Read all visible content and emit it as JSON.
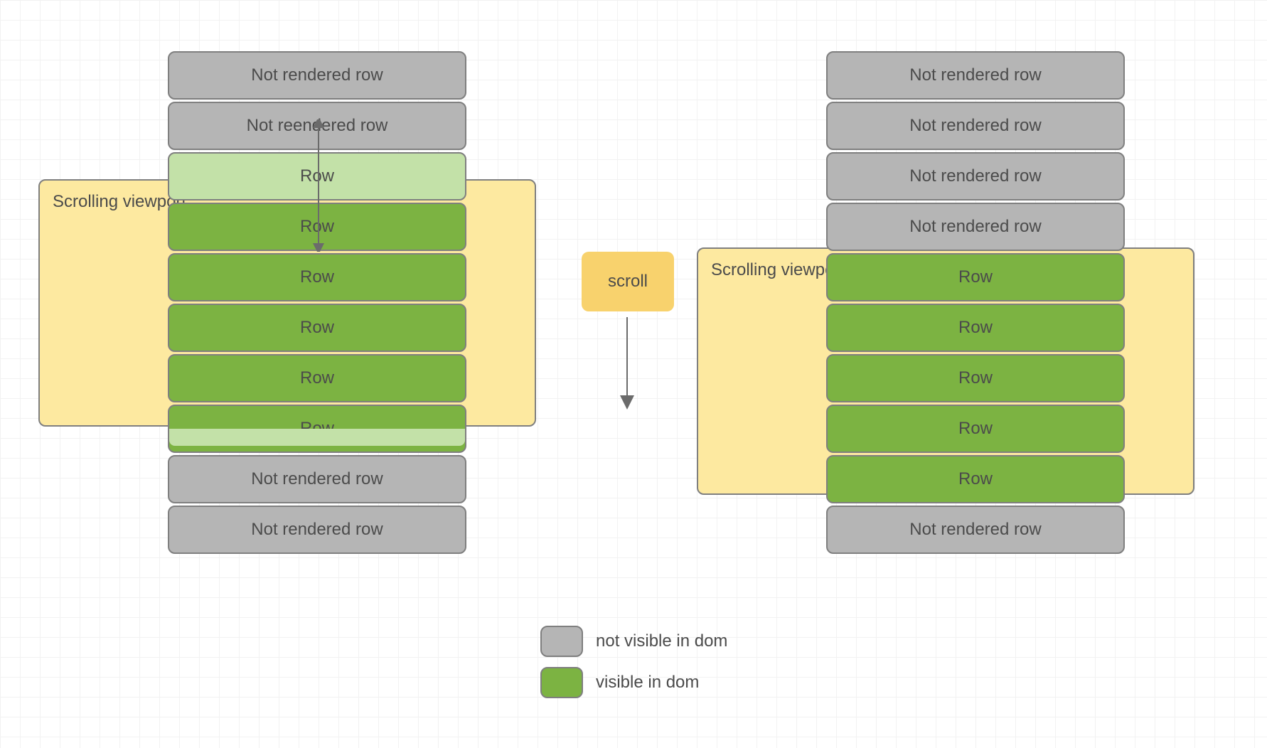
{
  "left": {
    "viewport_label": "Scrolling viewport",
    "rows": [
      {
        "label": "Not rendered row",
        "state": "grey"
      },
      {
        "label": "Not reendered row",
        "state": "grey"
      },
      {
        "label": "Row",
        "state": "light-green"
      },
      {
        "label": "Row",
        "state": "green"
      },
      {
        "label": "Row",
        "state": "green"
      },
      {
        "label": "Row",
        "state": "green"
      },
      {
        "label": "Row",
        "state": "green"
      },
      {
        "label": "Row",
        "state": "green"
      },
      {
        "label": "Not rendered row",
        "state": "grey"
      },
      {
        "label": "Not rendered row",
        "state": "grey"
      }
    ]
  },
  "right": {
    "viewport_label": "Scrolling viewport",
    "rows": [
      {
        "label": "Not rendered row",
        "state": "grey"
      },
      {
        "label": "Not rendered row",
        "state": "grey"
      },
      {
        "label": "Not rendered row",
        "state": "grey"
      },
      {
        "label": "Not rendered row",
        "state": "grey"
      },
      {
        "label": "Row",
        "state": "green"
      },
      {
        "label": "Row",
        "state": "green"
      },
      {
        "label": "Row",
        "state": "green"
      },
      {
        "label": "Row",
        "state": "green"
      },
      {
        "label": "Row",
        "state": "green"
      },
      {
        "label": "Not rendered row",
        "state": "grey"
      }
    ]
  },
  "scroll_label": "scroll",
  "legend": {
    "not_visible": "not visible in dom",
    "visible": "visible in dom"
  }
}
